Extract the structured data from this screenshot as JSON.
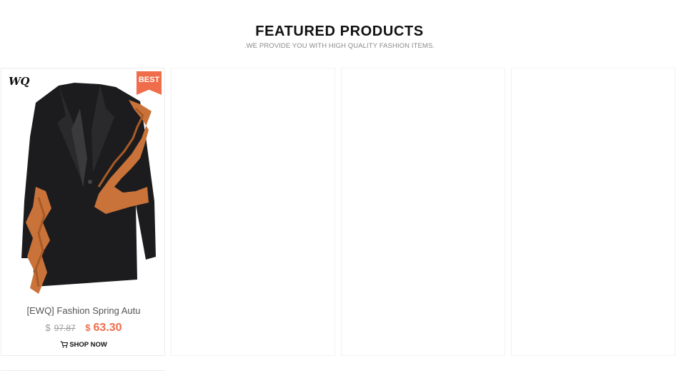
{
  "section": {
    "title": "FEATURED PRODUCTS",
    "subtitle": ".WE PROVIDE YOU WITH HIGH QUALITY FASHION ITEMS."
  },
  "products": [
    {
      "brand_logo": "WQ",
      "badge": "BEST",
      "name": "[EWQ] Fashion Spring Autu",
      "old_currency": "$",
      "old_price": "97.87",
      "new_currency": "$",
      "new_price": "63.30",
      "cta": "SHOP NOW",
      "icon": "cart-icon"
    }
  ],
  "colors": {
    "accent": "#ef6d4a",
    "jacket": "#1c1c1e",
    "ruffle": "#c9733a"
  }
}
